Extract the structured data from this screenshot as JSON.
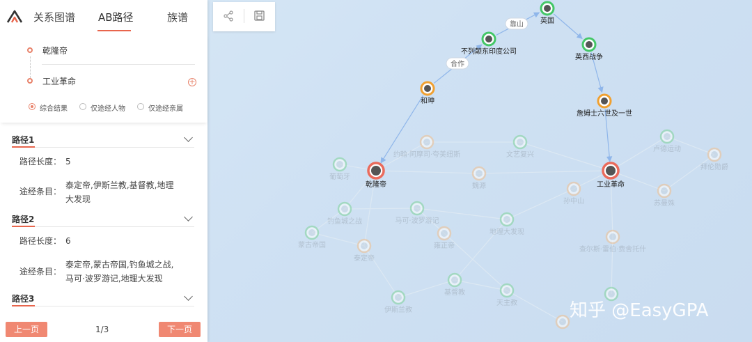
{
  "tabs": [
    {
      "label": "关系图谱",
      "active": false
    },
    {
      "label": "AB路径",
      "active": true
    },
    {
      "label": "族谱",
      "active": false
    }
  ],
  "query": {
    "start": "乾隆帝",
    "end": "工业革命",
    "options": [
      {
        "label": "综合结果",
        "selected": true
      },
      {
        "label": "仅途经人物",
        "selected": false
      },
      {
        "label": "仅途经亲属",
        "selected": false
      }
    ]
  },
  "paths": [
    {
      "title": "路径1",
      "length_label": "路径长度：",
      "length": "5",
      "items_label": "途经条目：",
      "items_line1": "泰定帝,伊斯兰教,基督教,地理",
      "items_line2": "大发现"
    },
    {
      "title": "路径2",
      "length_label": "路径长度：",
      "length": "6",
      "items_label": "途经条目：",
      "items_line1": "泰定帝,蒙古帝国,钓鱼城之战,",
      "items_line2": "马可·波罗游记,地理大发现"
    },
    {
      "title": "路径3"
    }
  ],
  "pagination": {
    "prev": "上一页",
    "next": "下一页",
    "page": "1/3"
  },
  "toolbar": {
    "share_icon": "share-icon",
    "save_icon": "save-icon"
  },
  "graph": {
    "nodes": [
      {
        "label": "英国",
        "style": "highlight",
        "color": "#44c767"
      },
      {
        "label": "不列颠东印度公司",
        "style": "highlight",
        "color": "#44c767"
      },
      {
        "label": "英西战争",
        "style": "highlight",
        "color": "#44c767"
      },
      {
        "label": "和珅",
        "style": "highlight",
        "color": "#f0a030"
      },
      {
        "label": "詹姆士六世及一世",
        "style": "highlight",
        "color": "#f0a030"
      },
      {
        "label": "乾隆帝",
        "style": "endpoint",
        "color": "#ea6b5c"
      },
      {
        "label": "工业革命",
        "style": "endpoint",
        "color": "#ea6b5c"
      },
      {
        "label": "约翰·阿摩司·夸美纽斯",
        "style": "faded",
        "color": "#f0c090"
      },
      {
        "label": "文艺复兴",
        "style": "faded",
        "color": "#7fd39a"
      },
      {
        "label": "卢德运动",
        "style": "faded",
        "color": "#7fd39a"
      },
      {
        "label": "拜伦勋爵",
        "style": "faded",
        "color": "#f0c090"
      },
      {
        "label": "葡萄牙",
        "style": "faded",
        "color": "#7fd39a"
      },
      {
        "label": "魏源",
        "style": "faded",
        "color": "#f0c090"
      },
      {
        "label": "孙中山",
        "style": "faded",
        "color": "#f0c090"
      },
      {
        "label": "苏曼殊",
        "style": "faded",
        "color": "#f0c090"
      },
      {
        "label": "钓鱼城之战",
        "style": "faded",
        "color": "#7fd39a"
      },
      {
        "label": "马可·波罗游记",
        "style": "faded",
        "color": "#7fd39a"
      },
      {
        "label": "蒙古帝国",
        "style": "faded",
        "color": "#7fd39a"
      },
      {
        "label": "雍正帝",
        "style": "faded",
        "color": "#f0c090"
      },
      {
        "label": "地理大发现",
        "style": "faded",
        "color": "#7fd39a"
      },
      {
        "label": "泰定帝",
        "style": "faded",
        "color": "#f0c090"
      },
      {
        "label": "查尔斯·雷伯·费舍托什",
        "style": "faded",
        "color": "#f0c090"
      },
      {
        "label": "基督教",
        "style": "faded",
        "color": "#7fd39a"
      },
      {
        "label": "伊斯兰教",
        "style": "faded",
        "color": "#7fd39a"
      },
      {
        "label": "天主教",
        "style": "faded",
        "color": "#7fd39a"
      },
      {
        "label": "",
        "style": "faded",
        "color": "#7fd39a"
      },
      {
        "label": "",
        "style": "faded",
        "color": "#f0c090"
      }
    ],
    "edge_labels": [
      "靠山",
      "合作"
    ]
  },
  "watermark": "知乎 @EasyGPA"
}
